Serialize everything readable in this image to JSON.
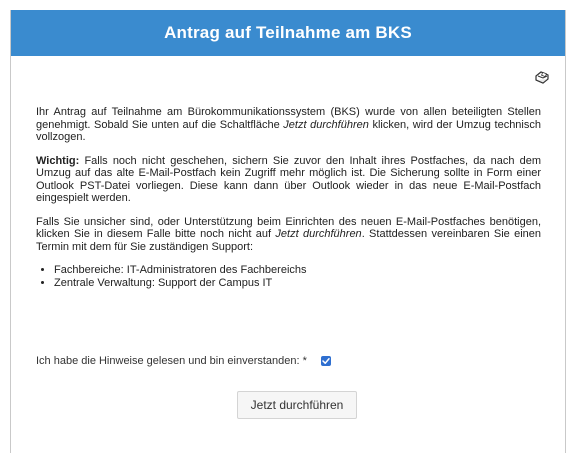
{
  "header": {
    "title": "Antrag auf Teilnahme am BKS"
  },
  "icons": {
    "print": "print-icon",
    "check": "check-icon"
  },
  "colors": {
    "header_bg": "#3a8bcf",
    "checkbox": "#2f6fd0"
  },
  "content": {
    "p1_a": "Ihr Antrag auf Teilnahme am Bürokommunikationssystem (BKS) wurde von allen beteiligten Stellen genehmigt. Sobald Sie unten auf die Schaltfläche ",
    "p1_em": "Jetzt durchführen",
    "p1_b": " klicken, wird der Umzug technisch vollzogen.",
    "p2_strong": "Wichtig:",
    "p2_text": " Falls noch nicht geschehen, sichern Sie zuvor den Inhalt ihres Postfaches, da nach dem Umzug auf das alte E-Mail-Postfach kein Zugriff mehr möglich ist. Die Sicherung sollte in Form einer Outlook PST-Datei vorliegen. Diese kann dann über Outlook wieder in das neue E-Mail-Postfach eingespielt werden.",
    "p3_a": "Falls Sie unsicher sind, oder Unterstützung beim Einrichten des neuen E-Mail-Postfaches benötigen, klicken Sie in diesem Falle bitte noch nicht auf ",
    "p3_em": "Jetzt durchführen",
    "p3_b": ". Stattdessen vereinbaren Sie einen Termin mit dem für Sie zuständigen Support:",
    "list": [
      "Fachbereiche: IT-Administratoren des Fachbereichs",
      "Zentrale Verwaltung: Support der Campus IT"
    ]
  },
  "consent": {
    "label": "Ich habe die Hinweise gelesen und bin einverstanden: *",
    "checked": true
  },
  "actions": {
    "submit_label": "Jetzt durchführen"
  }
}
